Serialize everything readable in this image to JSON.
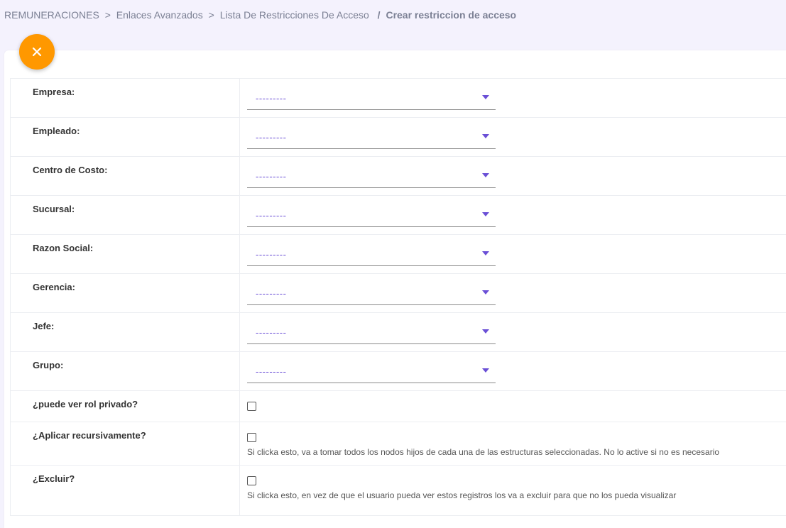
{
  "breadcrumb": {
    "items": [
      "REMUNERACIONES",
      "Enlaces Avanzados",
      "Lista De Restricciones De Acceso"
    ],
    "separator": ">",
    "current_separator": "/",
    "current": "Crear restriccion de acceso"
  },
  "close_button": {
    "icon": "close-icon",
    "color": "#ff9800"
  },
  "fields": [
    {
      "label": "Empresa:",
      "value": "---------"
    },
    {
      "label": "Empleado:",
      "value": "---------"
    },
    {
      "label": "Centro de Costo:",
      "value": "---------"
    },
    {
      "label": "Sucursal:",
      "value": "---------"
    },
    {
      "label": "Razon Social:",
      "value": "---------"
    },
    {
      "label": "Gerencia:",
      "value": "---------"
    },
    {
      "label": "Jefe:",
      "value": "---------"
    },
    {
      "label": "Grupo:",
      "value": "---------"
    }
  ],
  "checkboxes": [
    {
      "label": "¿puede ver rol privado?",
      "help": ""
    },
    {
      "label": "¿Aplicar recursivamente?",
      "help": "Si clicka esto, va a tomar todos los nodos hijos de cada una de las estructuras seleccionadas. No lo active si no es necesario"
    },
    {
      "label": "¿Excluir?",
      "help": "Si clicka esto, en vez de que el usuario pueda ver estos registros los va a excluir para que no los pueda visualizar"
    }
  ],
  "colors": {
    "accent": "#6a4fd6",
    "background": "#f4f2fd"
  }
}
